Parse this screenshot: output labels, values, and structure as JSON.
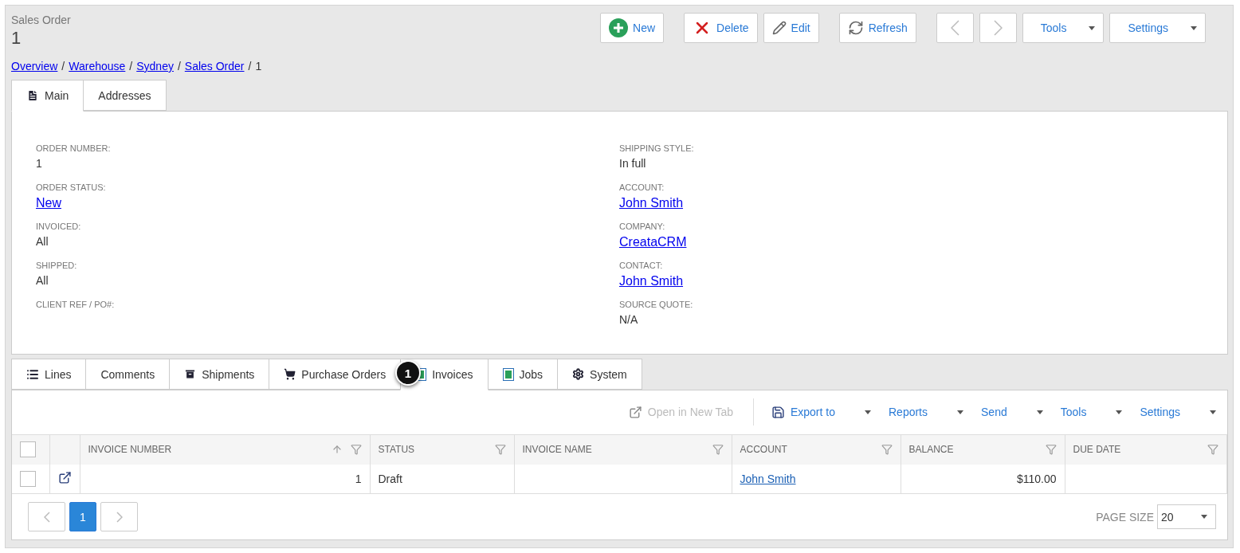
{
  "header": {
    "caption": "Sales Order",
    "title": "1"
  },
  "toolbar": [
    {
      "buttons": [
        {
          "kind": "new",
          "label": "New"
        }
      ]
    },
    {
      "buttons": [
        {
          "kind": "delete",
          "label": "Delete"
        },
        {
          "kind": "edit",
          "label": "Edit"
        }
      ]
    },
    {
      "buttons": [
        {
          "kind": "refresh",
          "label": "Refresh"
        }
      ]
    },
    {
      "buttons": [
        {
          "kind": "prev"
        },
        {
          "kind": "next"
        },
        {
          "kind": "dropdown",
          "label": "Tools"
        },
        {
          "kind": "dropdown",
          "label": "Settings"
        }
      ]
    }
  ],
  "breadcrumb": [
    {
      "label": "Overview",
      "kind": "link"
    },
    {
      "label": "/",
      "kind": "separator"
    },
    {
      "label": "Warehouse",
      "kind": "link"
    },
    {
      "label": "/",
      "kind": "separator"
    },
    {
      "label": "Sydney",
      "kind": "link"
    },
    {
      "label": "/",
      "kind": "separator"
    },
    {
      "label": "Sales Order",
      "kind": "link"
    },
    {
      "label": "/",
      "kind": "separator"
    },
    {
      "label": "1",
      "kind": "current"
    }
  ],
  "main_tabs": [
    {
      "label": "Main",
      "kind": "document",
      "selected": true
    },
    {
      "label": "Addresses",
      "kind": "plain",
      "selected": false
    }
  ],
  "fields_left": [
    {
      "label": "ORDER NUMBER:",
      "value": "1",
      "kind": "text"
    },
    {
      "label": "ORDER STATUS:",
      "value": "New",
      "kind": "link"
    },
    {
      "label": "INVOICED:",
      "value": "All",
      "kind": "text"
    },
    {
      "label": "SHIPPED:",
      "value": "All",
      "kind": "text"
    },
    {
      "label": "CLIENT REF / PO#:",
      "kind": "empty"
    }
  ],
  "fields_right": [
    {
      "label": "SHIPPING STYLE:",
      "value": "In full",
      "kind": "text"
    },
    {
      "label": "ACCOUNT:",
      "value": "John Smith",
      "kind": "link"
    },
    {
      "label": "COMPANY:",
      "value": "CreataCRM",
      "kind": "link"
    },
    {
      "label": "CONTACT:",
      "value": "John Smith",
      "kind": "link"
    },
    {
      "label": "SOURCE QUOTE:",
      "value": "N/A",
      "kind": "text"
    }
  ],
  "detail_tabs": [
    {
      "label": "Lines",
      "kind": "list",
      "selected": false
    },
    {
      "label": "Comments",
      "kind": "plain",
      "selected": false
    },
    {
      "label": "Shipments",
      "kind": "box",
      "selected": false
    },
    {
      "label": "Purchase Orders",
      "kind": "cart",
      "selected": false
    },
    {
      "label": "Invoices",
      "kind": "invoice",
      "selected": true
    },
    {
      "label": "Jobs",
      "kind": "invoice",
      "selected": false
    },
    {
      "label": "System",
      "kind": "gear",
      "selected": false
    }
  ],
  "callout": {
    "label": "1"
  },
  "grid_toolbar": [
    {
      "label": "Open in New Tab",
      "kind": "open",
      "disabled": true
    },
    {
      "label": "Export to",
      "kind": "export",
      "disabled": false
    },
    {
      "label": "Reports",
      "kind": "dropdown",
      "disabled": false
    },
    {
      "label": "Send",
      "kind": "dropdown",
      "disabled": false
    },
    {
      "label": "Tools",
      "kind": "dropdown",
      "disabled": false
    },
    {
      "label": "Settings",
      "kind": "dropdown",
      "disabled": false
    }
  ],
  "table": {
    "select_all_checked": false,
    "columns": [
      {
        "label": "INVOICE NUMBER",
        "sort_ascending": true,
        "filter": true
      },
      {
        "label": "STATUS",
        "filter": true
      },
      {
        "label": "INVOICE NAME",
        "filter": true
      },
      {
        "label": "ACCOUNT",
        "filter": true
      },
      {
        "label": "BALANCE",
        "filter": true
      },
      {
        "label": "DUE DATE",
        "filter": true
      }
    ],
    "rows": [
      {
        "checked": false,
        "invoice_number": "1",
        "status": "Draft",
        "account": "John Smith",
        "balance": "$110.00"
      }
    ]
  },
  "pager": {
    "pages": [
      {
        "label": "1",
        "selected": true
      }
    ],
    "page_size_label": "PAGE SIZE",
    "page_size": "20"
  }
}
